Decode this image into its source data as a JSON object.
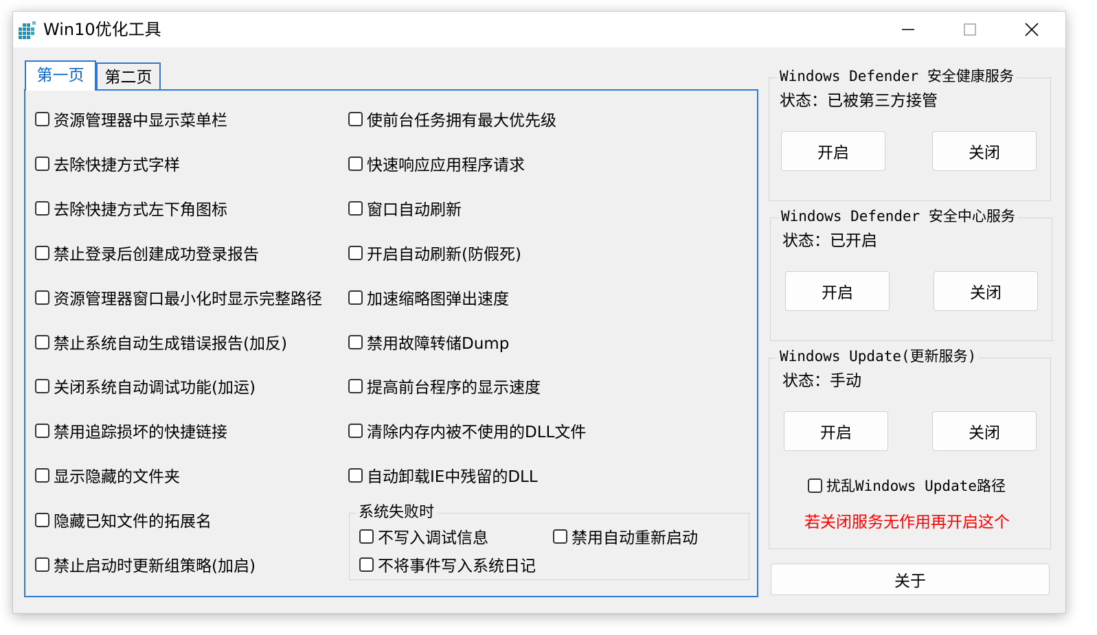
{
  "window": {
    "title": "Win10优化工具",
    "icon": "grid-app-icon",
    "controls": [
      "minimize-icon",
      "maximize-icon",
      "close-icon"
    ]
  },
  "tabs": [
    {
      "label": "第一页",
      "active": true
    },
    {
      "label": "第二页",
      "active": false
    }
  ],
  "left_column": [
    "资源管理器中显示菜单栏",
    "去除快捷方式字样",
    "去除快捷方式左下角图标",
    "禁止登录后创建成功登录报告",
    "资源管理器窗口最小化时显示完整路径",
    "禁止系统自动生成错误报告(加反)",
    "关闭系统自动调试功能(加运)",
    "禁用追踪损坏的快捷链接",
    "显示隐藏的文件夹",
    "隐藏已知文件的拓展名",
    "禁止启动时更新组策略(加启)"
  ],
  "right_column": [
    "使前台任务拥有最大优先级",
    "快速响应应用程序请求",
    "窗口自动刷新",
    "开启自动刷新(防假死)",
    "加速缩略图弹出速度",
    "禁用故障转储Dump",
    "提高前台程序的显示速度",
    "清除内存内被不使用的DLL文件",
    "自动卸载IE中残留的DLL"
  ],
  "failure_group": {
    "title": "系统失败时",
    "items": [
      "不写入调试信息",
      "禁用自动重新启动",
      "不将事件写入系统日记"
    ]
  },
  "services": [
    {
      "title": "Windows Defender 安全健康服务",
      "status": "状态：已被第三方接管",
      "on_label": "开启",
      "off_label": "关闭"
    },
    {
      "title": "Windows Defender 安全中心服务",
      "status": "状态：已开启",
      "on_label": "开启",
      "off_label": "关闭"
    },
    {
      "title": "Windows Update(更新服务)",
      "status": "状态：手动",
      "on_label": "开启",
      "off_label": "关闭"
    }
  ],
  "update_path_checkbox": "扰乱Windows Update路径",
  "warning_note": "若关闭服务无作用再开启这个",
  "about_label": "关于",
  "colors": {
    "tab_accent": "#2b79d4",
    "active_tab_text": "#0a64c8",
    "warning": "#ff0000",
    "window_bg": "#f0f0f0"
  }
}
